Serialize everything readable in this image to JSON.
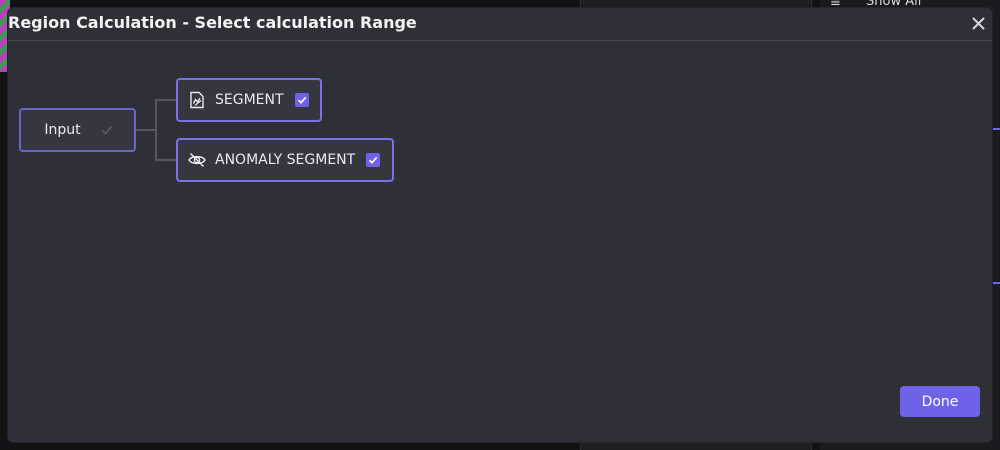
{
  "dialog": {
    "title": "Region Calculation - Select calculation Range",
    "close_icon": "close-icon",
    "done_label": "Done"
  },
  "tree": {
    "root": {
      "label": "Input",
      "checked": true,
      "disabled": true
    },
    "children": [
      {
        "label": "SEGMENT",
        "icon": "segment-icon",
        "checked": true
      },
      {
        "label": "ANOMALY SEGMENT",
        "icon": "eye-off-icon",
        "checked": true
      }
    ]
  },
  "background": {
    "show_all_label": "Show All",
    "list_icon": "list-icon"
  },
  "colors": {
    "accent": "#6e62e8",
    "node_border": "#7a72e6",
    "dialog_bg": "#2f3037"
  }
}
